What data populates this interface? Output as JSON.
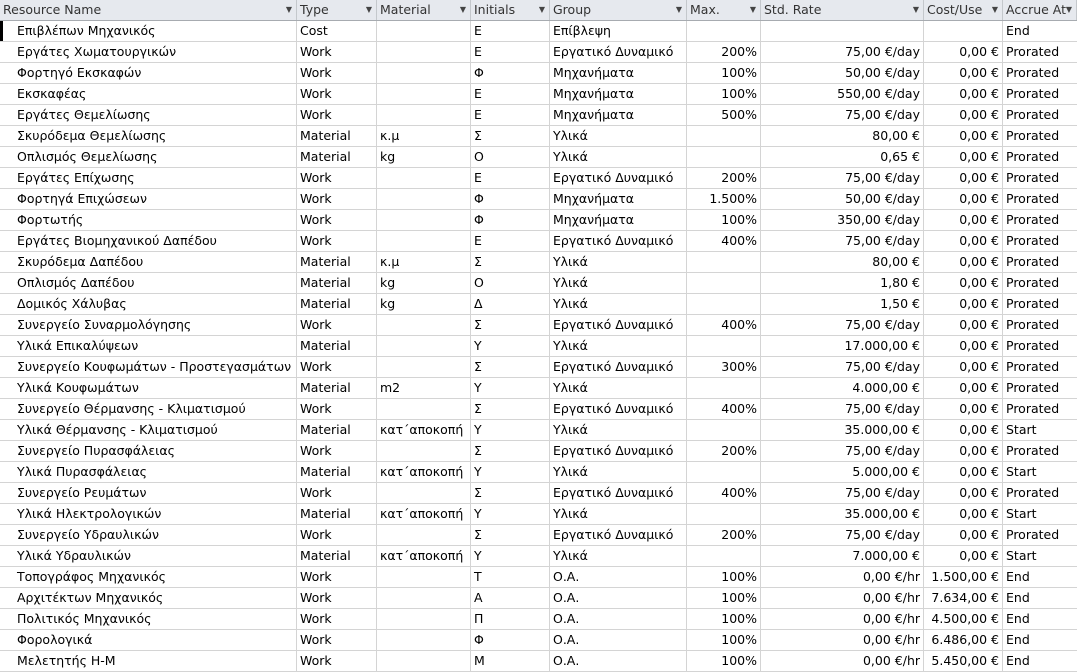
{
  "columns": [
    "Resource Name",
    "Type",
    "Material",
    "Initials",
    "Group",
    "Max.",
    "Std. Rate",
    "Cost/Use",
    "Accrue At"
  ],
  "rows": [
    [
      "Επιβλέπων Μηχανικός",
      "Cost",
      "",
      "Ε",
      "Επίβλεψη",
      "",
      "",
      "",
      "End"
    ],
    [
      "Εργάτες Χωματουργικών",
      "Work",
      "",
      "Ε",
      "Εργατικό Δυναμικό",
      "200%",
      "75,00 €/day",
      "0,00 €",
      "Prorated"
    ],
    [
      "Φορτηγό Εκσκαφών",
      "Work",
      "",
      "Φ",
      "Μηχανήματα",
      "100%",
      "50,00 €/day",
      "0,00 €",
      "Prorated"
    ],
    [
      "Εκσκαφέας",
      "Work",
      "",
      "Ε",
      "Μηχανήματα",
      "100%",
      "550,00 €/day",
      "0,00 €",
      "Prorated"
    ],
    [
      "Εργάτες Θεμελίωσης",
      "Work",
      "",
      "Ε",
      "Μηχανήματα",
      "500%",
      "75,00 €/day",
      "0,00 €",
      "Prorated"
    ],
    [
      "Σκυρόδεμα Θεμελίωσης",
      "Material",
      "κ.μ",
      "Σ",
      "Υλικά",
      "",
      "80,00 €",
      "0,00 €",
      "Prorated"
    ],
    [
      "Οπλισμός Θεμελίωσης",
      "Material",
      "kg",
      "Ο",
      "Υλικά",
      "",
      "0,65 €",
      "0,00 €",
      "Prorated"
    ],
    [
      "Εργάτες Επίχωσης",
      "Work",
      "",
      "Ε",
      "Εργατικό Δυναμικό",
      "200%",
      "75,00 €/day",
      "0,00 €",
      "Prorated"
    ],
    [
      "Φορτηγά Επιχώσεων",
      "Work",
      "",
      "Φ",
      "Μηχανήματα",
      "1.500%",
      "50,00 €/day",
      "0,00 €",
      "Prorated"
    ],
    [
      "Φορτωτής",
      "Work",
      "",
      "Φ",
      "Μηχανήματα",
      "100%",
      "350,00 €/day",
      "0,00 €",
      "Prorated"
    ],
    [
      "Εργάτες Βιομηχανικού Δαπέδου",
      "Work",
      "",
      "Ε",
      "Εργατικό Δυναμικό",
      "400%",
      "75,00 €/day",
      "0,00 €",
      "Prorated"
    ],
    [
      "Σκυρόδεμα Δαπέδου",
      "Material",
      "κ.μ",
      "Σ",
      "Υλικά",
      "",
      "80,00 €",
      "0,00 €",
      "Prorated"
    ],
    [
      "Οπλισμός Δαπέδου",
      "Material",
      "kg",
      "Ο",
      "Υλικά",
      "",
      "1,80 €",
      "0,00 €",
      "Prorated"
    ],
    [
      "Δομικός Χάλυβας",
      "Material",
      "kg",
      "Δ",
      "Υλικά",
      "",
      "1,50 €",
      "0,00 €",
      "Prorated"
    ],
    [
      "Συνεργείο Συναρμολόγησης",
      "Work",
      "",
      "Σ",
      "Εργατικό Δυναμικό",
      "400%",
      "75,00 €/day",
      "0,00 €",
      "Prorated"
    ],
    [
      "Υλικά Επικαλύψεων",
      "Material",
      "",
      "Υ",
      "Υλικά",
      "",
      "17.000,00 €",
      "0,00 €",
      "Prorated"
    ],
    [
      "Συνεργείο Κουφωμάτων - Προστεγασμάτων",
      "Work",
      "",
      "Σ",
      "Εργατικό Δυναμικό",
      "300%",
      "75,00 €/day",
      "0,00 €",
      "Prorated"
    ],
    [
      "Υλικά Κουφωμάτων",
      "Material",
      "m2",
      "Υ",
      "Υλικά",
      "",
      "4.000,00 €",
      "0,00 €",
      "Prorated"
    ],
    [
      "Συνεργείο Θέρμανσης - Κλιματισμού",
      "Work",
      "",
      "Σ",
      "Εργατικό Δυναμικό",
      "400%",
      "75,00 €/day",
      "0,00 €",
      "Prorated"
    ],
    [
      "Υλικά Θέρμανσης - Κλιματισμού",
      "Material",
      "κατ΄αποκοπή",
      "Υ",
      "Υλικά",
      "",
      "35.000,00 €",
      "0,00 €",
      "Start"
    ],
    [
      "Συνεργείο Πυρασφάλειας",
      "Work",
      "",
      "Σ",
      "Εργατικό Δυναμικό",
      "200%",
      "75,00 €/day",
      "0,00 €",
      "Prorated"
    ],
    [
      "Υλικά Πυρασφάλειας",
      "Material",
      "κατ΄αποκοπή",
      "Υ",
      "Υλικά",
      "",
      "5.000,00 €",
      "0,00 €",
      "Start"
    ],
    [
      "Συνεργείο Ρευμάτων",
      "Work",
      "",
      "Σ",
      "Εργατικό Δυναμικό",
      "400%",
      "75,00 €/day",
      "0,00 €",
      "Prorated"
    ],
    [
      "Υλικά Ηλεκτρολογικών",
      "Material",
      "κατ΄αποκοπή",
      "Υ",
      "Υλικά",
      "",
      "35.000,00 €",
      "0,00 €",
      "Start"
    ],
    [
      "Συνεργείο Υδραυλικών",
      "Work",
      "",
      "Σ",
      "Εργατικό Δυναμικό",
      "200%",
      "75,00 €/day",
      "0,00 €",
      "Prorated"
    ],
    [
      "Υλικά Υδραυλικών",
      "Material",
      "κατ΄αποκοπή",
      "Υ",
      "Υλικά",
      "",
      "7.000,00 €",
      "0,00 €",
      "Start"
    ],
    [
      "Τοπογράφος Μηχανικός",
      "Work",
      "",
      "Τ",
      "Ο.Α.",
      "100%",
      "0,00 €/hr",
      "1.500,00 €",
      "End"
    ],
    [
      "Αρχιτέκτων Μηχανικός",
      "Work",
      "",
      "Α",
      "Ο.Α.",
      "100%",
      "0,00 €/hr",
      "7.634,00 €",
      "End"
    ],
    [
      "Πολιτικός Μηχανικός",
      "Work",
      "",
      "Π",
      "Ο.Α.",
      "100%",
      "0,00 €/hr",
      "4.500,00 €",
      "End"
    ],
    [
      "Φορολογικά",
      "Work",
      "",
      "Φ",
      "Ο.Α.",
      "100%",
      "0,00 €/hr",
      "6.486,00 €",
      "End"
    ],
    [
      "Μελετητής Η-Μ",
      "Work",
      "",
      "Μ",
      "Ο.Α.",
      "100%",
      "0,00 €/hr",
      "5.450,00 €",
      "End"
    ]
  ]
}
